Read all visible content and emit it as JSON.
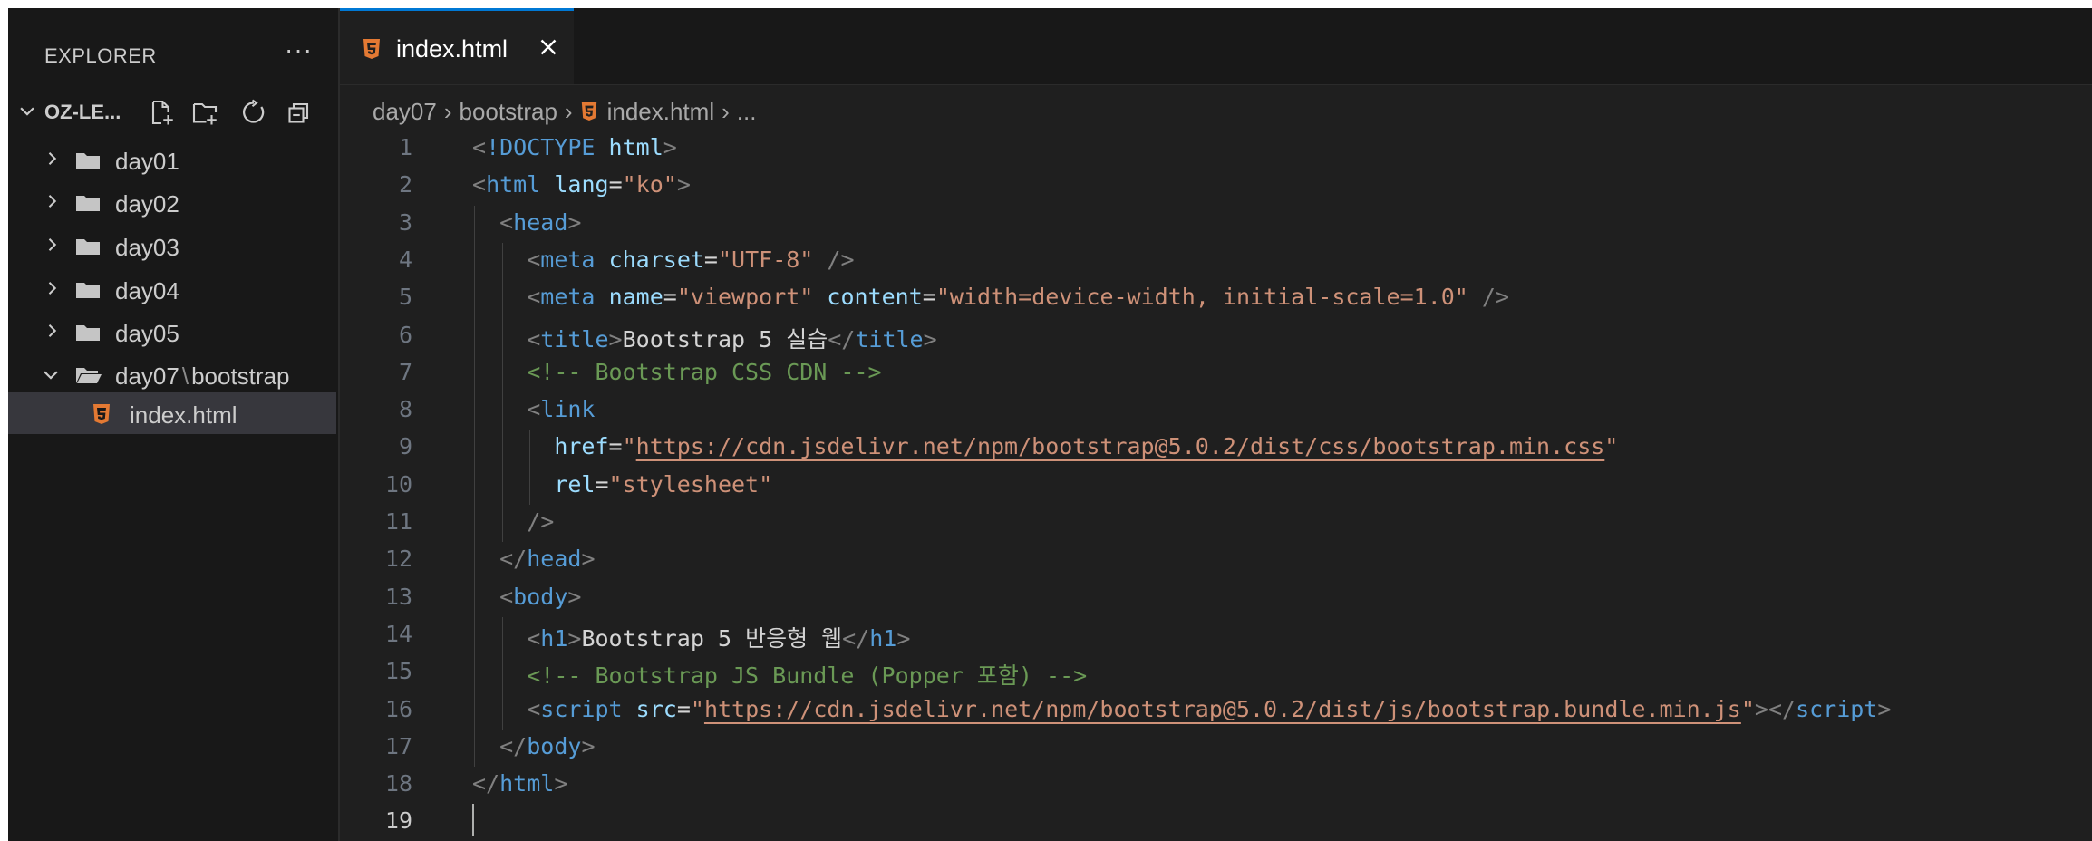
{
  "sidebar": {
    "header": "EXPLORER",
    "more": "···",
    "project": "OZ-LE...",
    "actions": [
      "new-file",
      "new-folder",
      "refresh",
      "collapse-all"
    ],
    "items": [
      {
        "label": "day01",
        "type": "folder",
        "expanded": false
      },
      {
        "label": "day02",
        "type": "folder",
        "expanded": false
      },
      {
        "label": "day03",
        "type": "folder",
        "expanded": false
      },
      {
        "label": "day04",
        "type": "folder",
        "expanded": false
      },
      {
        "label": "day05",
        "type": "folder",
        "expanded": false
      },
      {
        "label": "day07",
        "label_sep": "\\",
        "label_sub": "bootstrap",
        "type": "folder",
        "expanded": true
      },
      {
        "label": "index.html",
        "type": "html-file",
        "selected": true
      }
    ]
  },
  "tab": {
    "label": "index.html",
    "close": "✕"
  },
  "breadcrumb": {
    "seg1": "day07",
    "seg2": "bootstrap",
    "seg3": "index.html",
    "seg4": "...",
    "sep": "›"
  },
  "editor": {
    "active_line": 19,
    "lines": [
      {
        "n": "1",
        "tokens": [
          {
            "c": "t-punc",
            "t": "<"
          },
          {
            "c": "t-tag",
            "t": "!DOCTYPE"
          },
          {
            "c": "t-text",
            "t": " "
          },
          {
            "c": "t-attr",
            "t": "html"
          },
          {
            "c": "t-punc",
            "t": ">"
          }
        ]
      },
      {
        "n": "2",
        "tokens": [
          {
            "c": "t-punc",
            "t": "<"
          },
          {
            "c": "t-tag",
            "t": "html"
          },
          {
            "c": "t-text",
            "t": " "
          },
          {
            "c": "t-attr",
            "t": "lang"
          },
          {
            "c": "t-text",
            "t": "="
          },
          {
            "c": "t-str",
            "t": "\"ko\""
          },
          {
            "c": "t-punc",
            "t": ">"
          }
        ]
      },
      {
        "n": "3",
        "tokens": [
          {
            "c": "t-text",
            "t": "  "
          },
          {
            "c": "t-punc",
            "t": "<"
          },
          {
            "c": "t-tag",
            "t": "head"
          },
          {
            "c": "t-punc",
            "t": ">"
          }
        ]
      },
      {
        "n": "4",
        "tokens": [
          {
            "c": "t-text",
            "t": "    "
          },
          {
            "c": "t-punc",
            "t": "<"
          },
          {
            "c": "t-tag",
            "t": "meta"
          },
          {
            "c": "t-text",
            "t": " "
          },
          {
            "c": "t-attr",
            "t": "charset"
          },
          {
            "c": "t-text",
            "t": "="
          },
          {
            "c": "t-str",
            "t": "\"UTF-8\""
          },
          {
            "c": "t-text",
            "t": " "
          },
          {
            "c": "t-punc",
            "t": "/>"
          }
        ]
      },
      {
        "n": "5",
        "tokens": [
          {
            "c": "t-text",
            "t": "    "
          },
          {
            "c": "t-punc",
            "t": "<"
          },
          {
            "c": "t-tag",
            "t": "meta"
          },
          {
            "c": "t-text",
            "t": " "
          },
          {
            "c": "t-attr",
            "t": "name"
          },
          {
            "c": "t-text",
            "t": "="
          },
          {
            "c": "t-str",
            "t": "\"viewport\""
          },
          {
            "c": "t-text",
            "t": " "
          },
          {
            "c": "t-attr",
            "t": "content"
          },
          {
            "c": "t-text",
            "t": "="
          },
          {
            "c": "t-str",
            "t": "\"width=device-width, initial-scale=1.0\""
          },
          {
            "c": "t-text",
            "t": " "
          },
          {
            "c": "t-punc",
            "t": "/>"
          }
        ]
      },
      {
        "n": "6",
        "tokens": [
          {
            "c": "t-text",
            "t": "    "
          },
          {
            "c": "t-punc",
            "t": "<"
          },
          {
            "c": "t-tag",
            "t": "title"
          },
          {
            "c": "t-punc",
            "t": ">"
          },
          {
            "c": "t-text",
            "t": "Bootstrap 5 실습"
          },
          {
            "c": "t-punc",
            "t": "</"
          },
          {
            "c": "t-tag",
            "t": "title"
          },
          {
            "c": "t-punc",
            "t": ">"
          }
        ]
      },
      {
        "n": "7",
        "tokens": [
          {
            "c": "t-text",
            "t": "    "
          },
          {
            "c": "t-com",
            "t": "<!-- Bootstrap CSS CDN -->"
          }
        ]
      },
      {
        "n": "8",
        "tokens": [
          {
            "c": "t-text",
            "t": "    "
          },
          {
            "c": "t-punc",
            "t": "<"
          },
          {
            "c": "t-tag",
            "t": "link"
          }
        ]
      },
      {
        "n": "9",
        "tokens": [
          {
            "c": "t-text",
            "t": "      "
          },
          {
            "c": "t-attr",
            "t": "href"
          },
          {
            "c": "t-text",
            "t": "="
          },
          {
            "c": "t-str",
            "t": "\""
          },
          {
            "c": "t-link",
            "t": "https://cdn.jsdelivr.net/npm/bootstrap@5.0.2/dist/css/bootstrap.min.css"
          },
          {
            "c": "t-str",
            "t": "\""
          }
        ]
      },
      {
        "n": "10",
        "tokens": [
          {
            "c": "t-text",
            "t": "      "
          },
          {
            "c": "t-attr",
            "t": "rel"
          },
          {
            "c": "t-text",
            "t": "="
          },
          {
            "c": "t-str",
            "t": "\"stylesheet\""
          }
        ]
      },
      {
        "n": "11",
        "tokens": [
          {
            "c": "t-text",
            "t": "    "
          },
          {
            "c": "t-punc",
            "t": "/>"
          }
        ]
      },
      {
        "n": "12",
        "tokens": [
          {
            "c": "t-text",
            "t": "  "
          },
          {
            "c": "t-punc",
            "t": "</"
          },
          {
            "c": "t-tag",
            "t": "head"
          },
          {
            "c": "t-punc",
            "t": ">"
          }
        ]
      },
      {
        "n": "13",
        "tokens": [
          {
            "c": "t-text",
            "t": "  "
          },
          {
            "c": "t-punc",
            "t": "<"
          },
          {
            "c": "t-tag",
            "t": "body"
          },
          {
            "c": "t-punc",
            "t": ">"
          }
        ]
      },
      {
        "n": "14",
        "tokens": [
          {
            "c": "t-text",
            "t": "    "
          },
          {
            "c": "t-punc",
            "t": "<"
          },
          {
            "c": "t-tag",
            "t": "h1"
          },
          {
            "c": "t-punc",
            "t": ">"
          },
          {
            "c": "t-text",
            "t": "Bootstrap 5 반응형 웹"
          },
          {
            "c": "t-punc",
            "t": "</"
          },
          {
            "c": "t-tag",
            "t": "h1"
          },
          {
            "c": "t-punc",
            "t": ">"
          }
        ]
      },
      {
        "n": "15",
        "tokens": [
          {
            "c": "t-text",
            "t": "    "
          },
          {
            "c": "t-com",
            "t": "<!-- Bootstrap JS Bundle (Popper 포함) -->"
          }
        ]
      },
      {
        "n": "16",
        "tokens": [
          {
            "c": "t-text",
            "t": "    "
          },
          {
            "c": "t-punc",
            "t": "<"
          },
          {
            "c": "t-tag",
            "t": "script"
          },
          {
            "c": "t-text",
            "t": " "
          },
          {
            "c": "t-attr",
            "t": "src"
          },
          {
            "c": "t-text",
            "t": "="
          },
          {
            "c": "t-str",
            "t": "\""
          },
          {
            "c": "t-link",
            "t": "https://cdn.jsdelivr.net/npm/bootstrap@5.0.2/dist/js/bootstrap.bundle.min.js"
          },
          {
            "c": "t-str",
            "t": "\""
          },
          {
            "c": "t-punc",
            "t": "></"
          },
          {
            "c": "t-tag",
            "t": "script"
          },
          {
            "c": "t-punc",
            "t": ">"
          }
        ]
      },
      {
        "n": "17",
        "tokens": [
          {
            "c": "t-text",
            "t": "  "
          },
          {
            "c": "t-punc",
            "t": "</"
          },
          {
            "c": "t-tag",
            "t": "body"
          },
          {
            "c": "t-punc",
            "t": ">"
          }
        ]
      },
      {
        "n": "18",
        "tokens": [
          {
            "c": "t-punc",
            "t": "</"
          },
          {
            "c": "t-tag",
            "t": "html"
          },
          {
            "c": "t-punc",
            "t": ">"
          }
        ]
      },
      {
        "n": "19",
        "tokens": []
      }
    ]
  },
  "colors": {
    "accent": "#0078d4",
    "html_icon": "#e37933",
    "folder": "#c5c5c5"
  }
}
